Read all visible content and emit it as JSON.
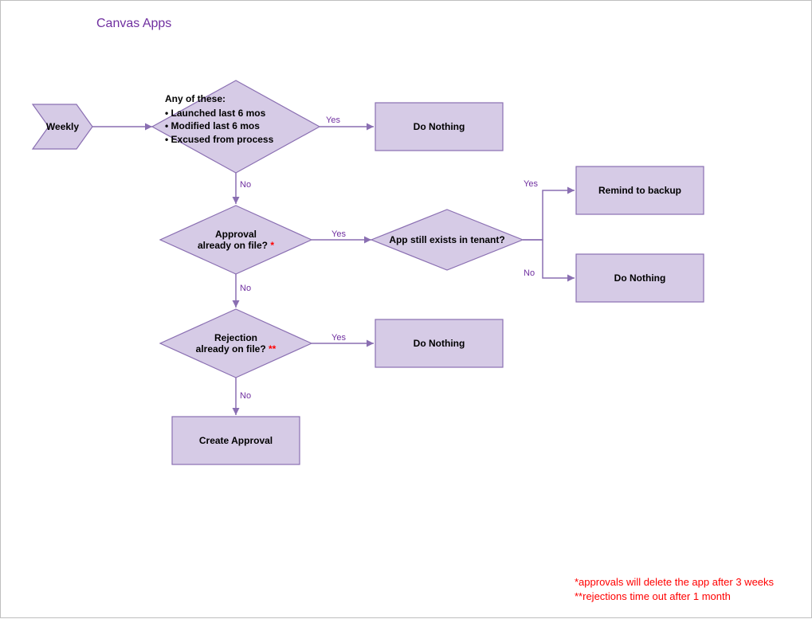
{
  "title": "Canvas Apps",
  "nodes": {
    "weekly": "Weekly",
    "cond1_hdr": "Any of these:",
    "cond1_b1": "Launched last 6 mos",
    "cond1_b2": "Modified last 6 mos",
    "cond1_b3": "Excused from process",
    "do_nothing_1": "Do Nothing",
    "approval_onfile": "Approval\nalready on file?",
    "app_exists": "App still exists in tenant?",
    "remind_backup": "Remind to backup",
    "do_nothing_2": "Do Nothing",
    "rejection_onfile": "Rejection\nalready on file?",
    "do_nothing_3": "Do Nothing",
    "create_approval": "Create Approval"
  },
  "edges": {
    "yes": "Yes",
    "no": "No"
  },
  "footnotes": {
    "f1": "*approvals will delete the app after 3 weeks",
    "f2": "**rejections time out after 1 month"
  },
  "asterisks": {
    "one": "*",
    "two": "**"
  },
  "chart_data": {
    "type": "flowchart",
    "title": "Canvas Apps",
    "nodes": [
      {
        "id": "weekly",
        "shape": "chevron",
        "label": "Weekly"
      },
      {
        "id": "cond_recent",
        "shape": "diamond",
        "label": "Any of these: Launched last 6 mos / Modified last 6 mos / Excused from process"
      },
      {
        "id": "dn1",
        "shape": "process",
        "label": "Do Nothing"
      },
      {
        "id": "approval_onfile",
        "shape": "diamond",
        "label": "Approval already on file? *"
      },
      {
        "id": "app_exists",
        "shape": "diamond",
        "label": "App still exists in tenant?"
      },
      {
        "id": "remind",
        "shape": "process",
        "label": "Remind to backup"
      },
      {
        "id": "dn2",
        "shape": "process",
        "label": "Do Nothing"
      },
      {
        "id": "rejection_onfile",
        "shape": "diamond",
        "label": "Rejection already on file? **"
      },
      {
        "id": "dn3",
        "shape": "process",
        "label": "Do Nothing"
      },
      {
        "id": "create_approval",
        "shape": "process",
        "label": "Create Approval"
      }
    ],
    "edges": [
      {
        "from": "weekly",
        "to": "cond_recent",
        "label": ""
      },
      {
        "from": "cond_recent",
        "to": "dn1",
        "label": "Yes"
      },
      {
        "from": "cond_recent",
        "to": "approval_onfile",
        "label": "No"
      },
      {
        "from": "approval_onfile",
        "to": "app_exists",
        "label": "Yes"
      },
      {
        "from": "app_exists",
        "to": "remind",
        "label": "Yes"
      },
      {
        "from": "app_exists",
        "to": "dn2",
        "label": "No"
      },
      {
        "from": "approval_onfile",
        "to": "rejection_onfile",
        "label": "No"
      },
      {
        "from": "rejection_onfile",
        "to": "dn3",
        "label": "Yes"
      },
      {
        "from": "rejection_onfile",
        "to": "create_approval",
        "label": "No"
      }
    ],
    "footnotes": [
      "*approvals will delete the app after 3 weeks",
      "**rejections time out after 1 month"
    ]
  }
}
